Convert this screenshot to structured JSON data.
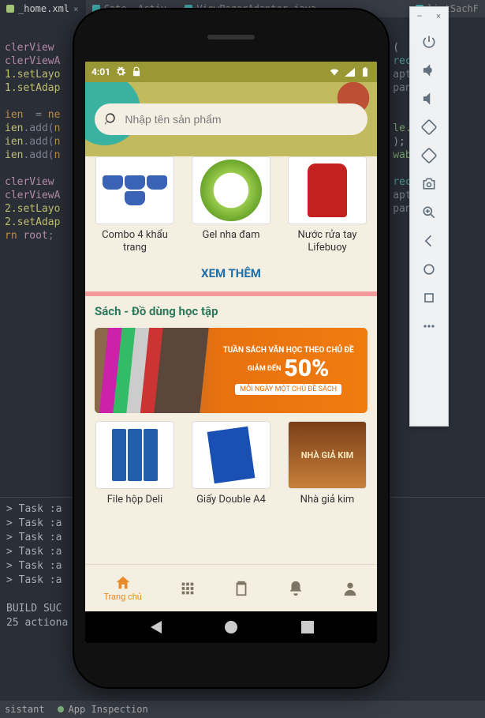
{
  "ide": {
    "tabs": [
      {
        "label": "_home.xml",
        "icon": "#8aa"
      },
      {
        "label": "Cate… Activ…",
        "icon": "#4aa"
      },
      {
        "label": "ViewPagerAdapter.java",
        "icon": "#4aa"
      },
      {
        "label": "listSachF",
        "icon": "#4aa"
      }
    ],
    "code_lines": [
      "clerView",
      "clerViewA",
      "1.setLayo",
      "1.setAdap",
      "",
      "ien  = ne",
      "ien.add(n",
      "ien.add(n",
      "ien.add(n",
      "",
      "clerView",
      "clerViewA",
      "2.setLayo",
      "2.setAdap",
      "rn root;"
    ],
    "code_right": [
      "(",
      "recycle",
      "apterT",
      "panCou",
      "",
      "",
      "le.ph",
      ");",
      "wable",
      "",
      "recycle",
      "apterT",
      "panCou"
    ],
    "terminal": [
      "> Task :a",
      "> Task :a",
      "> Task :a",
      "> Task :a",
      "> Task :a",
      "> Task :a",
      "",
      "BUILD SUC",
      "25 actiona"
    ],
    "status": {
      "assistant": "sistant",
      "inspection": "App Inspection"
    }
  },
  "emulator_tools": {
    "minimize": "–",
    "close": "×"
  },
  "android_status": {
    "time": "4:01"
  },
  "app": {
    "search_placeholder": "Nhập tên sản phẩm",
    "products1": [
      {
        "name": "Combo 4 khẩu trang",
        "thumb": "mask"
      },
      {
        "name": "Gel nha đam",
        "thumb": "aloe"
      },
      {
        "name": "Nước rửa tay Lifebuoy",
        "thumb": "lifebuoy"
      }
    ],
    "more_label": "XEM THÊM",
    "section2_title": "Sách - Đồ dùng học tập",
    "banner": {
      "line1": "TUẦN SÁCH VĂN HỌC THEO CHỦ ĐỀ",
      "giam": "GIẢM ĐẾN",
      "big": "50%",
      "line3": "MỖI NGÀY MỘT CHỦ ĐỀ SÁCH"
    },
    "products2": [
      {
        "name": "File hộp Deli",
        "thumb": "file"
      },
      {
        "name": "Giấy Double A4",
        "thumb": "a4"
      },
      {
        "name": "Nhà giả kim",
        "thumb": "book2",
        "caption": "NHÀ GIẢ KIM"
      }
    ],
    "nav": {
      "home": "Trang chủ"
    }
  }
}
